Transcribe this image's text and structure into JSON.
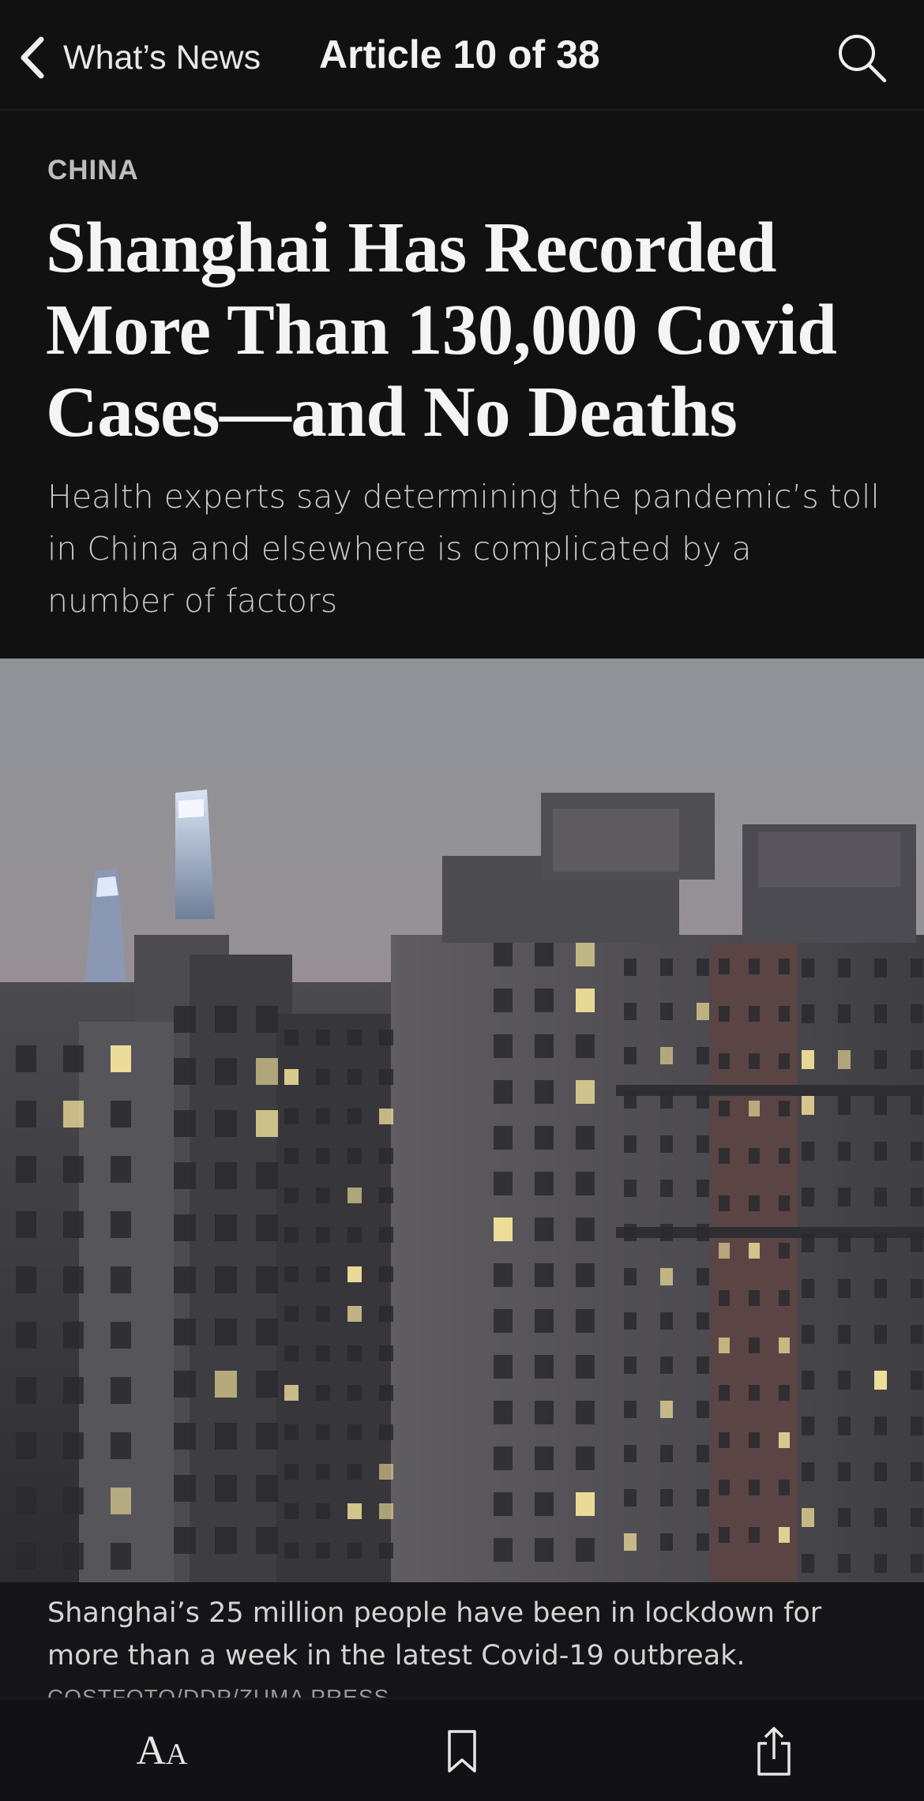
{
  "nav": {
    "back_label": "What’s News",
    "title": "Article 10 of 38",
    "icons": {
      "back": "chevron-left-icon",
      "search": "search-icon"
    }
  },
  "article": {
    "section": "CHINA",
    "headline": "Shanghai Has Recorded More Than 130,000 Covid Cases—and No Deaths",
    "dek": "Health experts say determining the pandemic’s toll in China and elsewhere is complicated by a number of factors",
    "image": {
      "subject": "Shanghai residential towers at dusk with skyscrapers behind",
      "caption": "Shanghai’s 25 million people have been in lockdown for more than a week in the latest Covid-19 outbreak.",
      "credit": "COSTFOTO/DDP/ZUMA PRESS"
    }
  },
  "toolbar": {
    "text_size_big": "A",
    "text_size_small": "A",
    "icons": {
      "text_size": "text-size-icon",
      "bookmark": "bookmark-icon",
      "share": "share-icon"
    }
  },
  "colors": {
    "background": "#111112",
    "headline": "#f4f4f4",
    "dek": "#c9c9c9",
    "kicker": "#bdbdbd",
    "window_light": "#f0df9a"
  }
}
